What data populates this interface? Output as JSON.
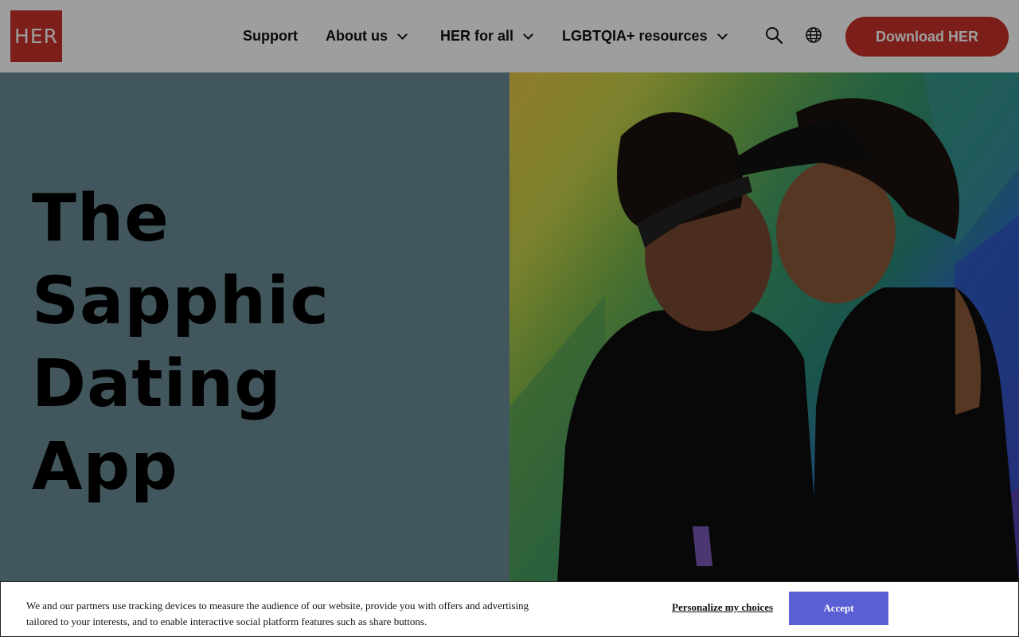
{
  "header": {
    "logo_text": "HER",
    "nav": {
      "support": "Support",
      "about": "About us",
      "her_for_all": "HER for all",
      "lgbt": "LGBTQIA+ resources"
    },
    "download_label": "Download HER"
  },
  "hero": {
    "title_lines": [
      "The",
      "Sapphic",
      "Dating",
      "App"
    ],
    "image_alt": "Two women kissing in front of a rainbow wall"
  },
  "cookie_banner": {
    "text": "We and our partners use tracking devices to measure the audience of our website, provide you with offers and advertising tailored to your interests, and to enable interactive social platform features such as share buttons.",
    "personalize_label": "Personalize my choices",
    "accept_label": "Accept"
  },
  "colors": {
    "brand_red": "#c9322a",
    "hero_bg": "#6b8d96",
    "accept_button": "#5b5fd6"
  },
  "icons": [
    "search-icon",
    "globe-icon",
    "chevron-down-icon"
  ]
}
